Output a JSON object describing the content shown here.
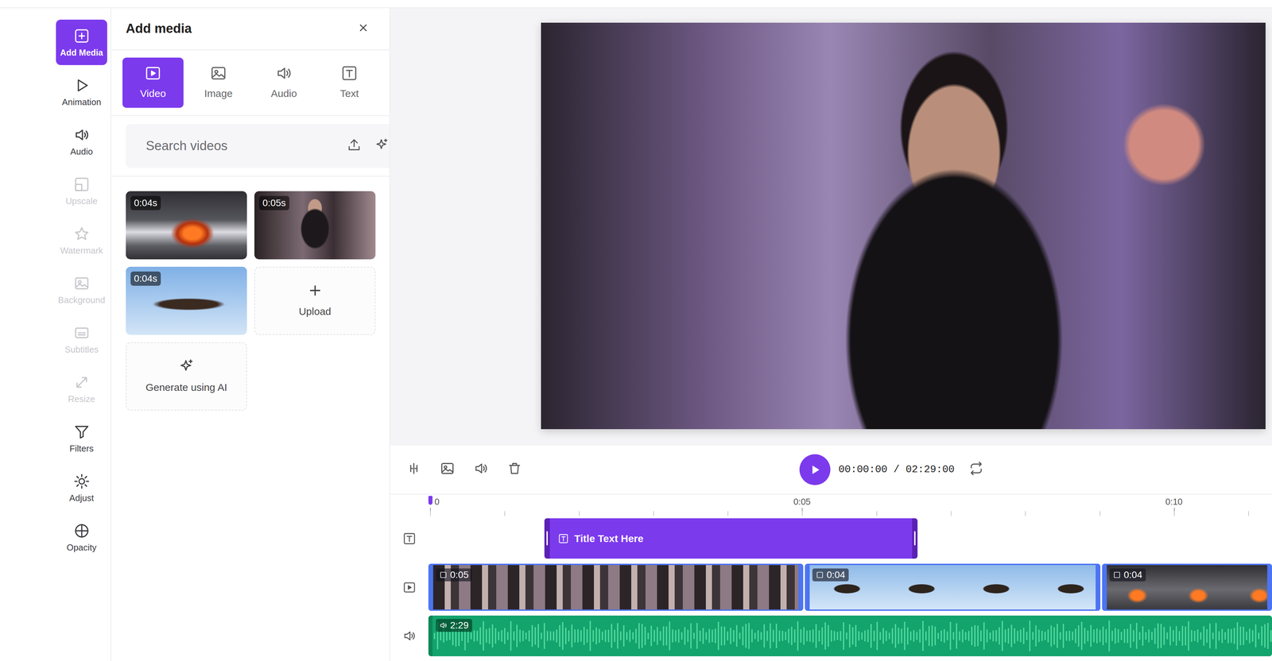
{
  "rail": [
    {
      "label": "Add Media",
      "selected": true,
      "disabled": false
    },
    {
      "label": "Animation",
      "selected": false,
      "disabled": false
    },
    {
      "label": "Audio",
      "selected": false,
      "disabled": false
    },
    {
      "label": "Upscale",
      "selected": false,
      "disabled": true
    },
    {
      "label": "Watermark",
      "selected": false,
      "disabled": true
    },
    {
      "label": "Background",
      "selected": false,
      "disabled": true
    },
    {
      "label": "Subtitles",
      "selected": false,
      "disabled": true
    },
    {
      "label": "Resize",
      "selected": false,
      "disabled": true
    },
    {
      "label": "Filters",
      "selected": false,
      "disabled": false
    },
    {
      "label": "Adjust",
      "selected": false,
      "disabled": false
    },
    {
      "label": "Opacity",
      "selected": false,
      "disabled": false
    }
  ],
  "panel": {
    "title": "Add media"
  },
  "tabs": [
    {
      "label": "Video",
      "selected": true
    },
    {
      "label": "Image",
      "selected": false
    },
    {
      "label": "Audio",
      "selected": false
    },
    {
      "label": "Text",
      "selected": false
    }
  ],
  "search": {
    "placeholder": "Search videos"
  },
  "media": [
    {
      "kind": "video",
      "duration": "0:04s"
    },
    {
      "kind": "video",
      "duration": "0:05s"
    },
    {
      "kind": "video",
      "duration": "0:04s"
    },
    {
      "kind": "upload",
      "label": "Upload"
    },
    {
      "kind": "generate",
      "label": "Generate using AI"
    }
  ],
  "player": {
    "current": "00:00:00",
    "separator": "/",
    "total": "02:29:00"
  },
  "timeline": {
    "ruler": [
      "0",
      "0:05",
      "0:10"
    ],
    "text_clips": [
      {
        "label": "Title Text Here"
      }
    ],
    "video_clips": [
      {
        "duration": "0:05"
      },
      {
        "duration": "0:04"
      },
      {
        "duration": "0:04"
      }
    ],
    "audio_clips": [
      {
        "duration": "2:29"
      }
    ]
  }
}
